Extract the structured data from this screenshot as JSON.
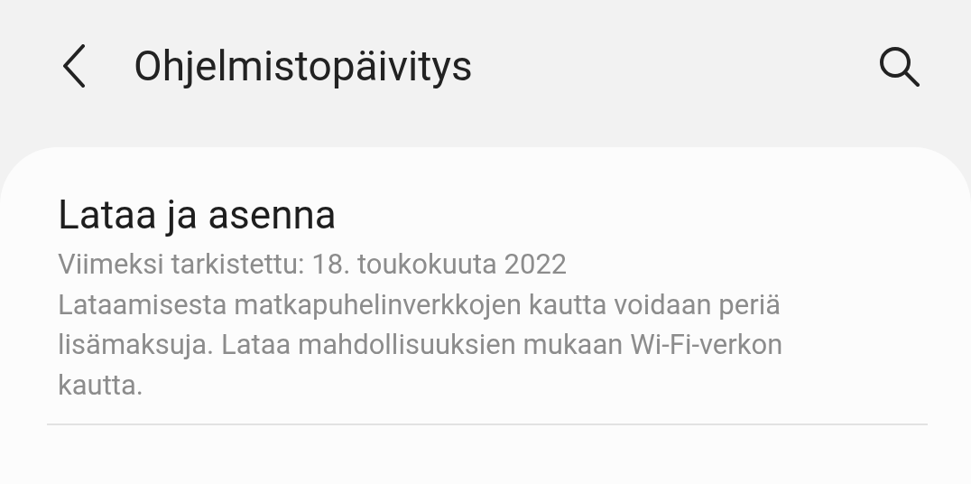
{
  "header": {
    "title": "Ohjelmistopäivitys"
  },
  "items": [
    {
      "title": "Lataa ja asenna",
      "last_checked": "Viimeksi tarkistettu: 18. toukokuuta 2022",
      "note": "Lataamisesta matkapuhelinverkkojen kautta voidaan periä lisämaksuja. Lataa mahdollisuuksien mukaan Wi-Fi-verkon kautta."
    }
  ]
}
